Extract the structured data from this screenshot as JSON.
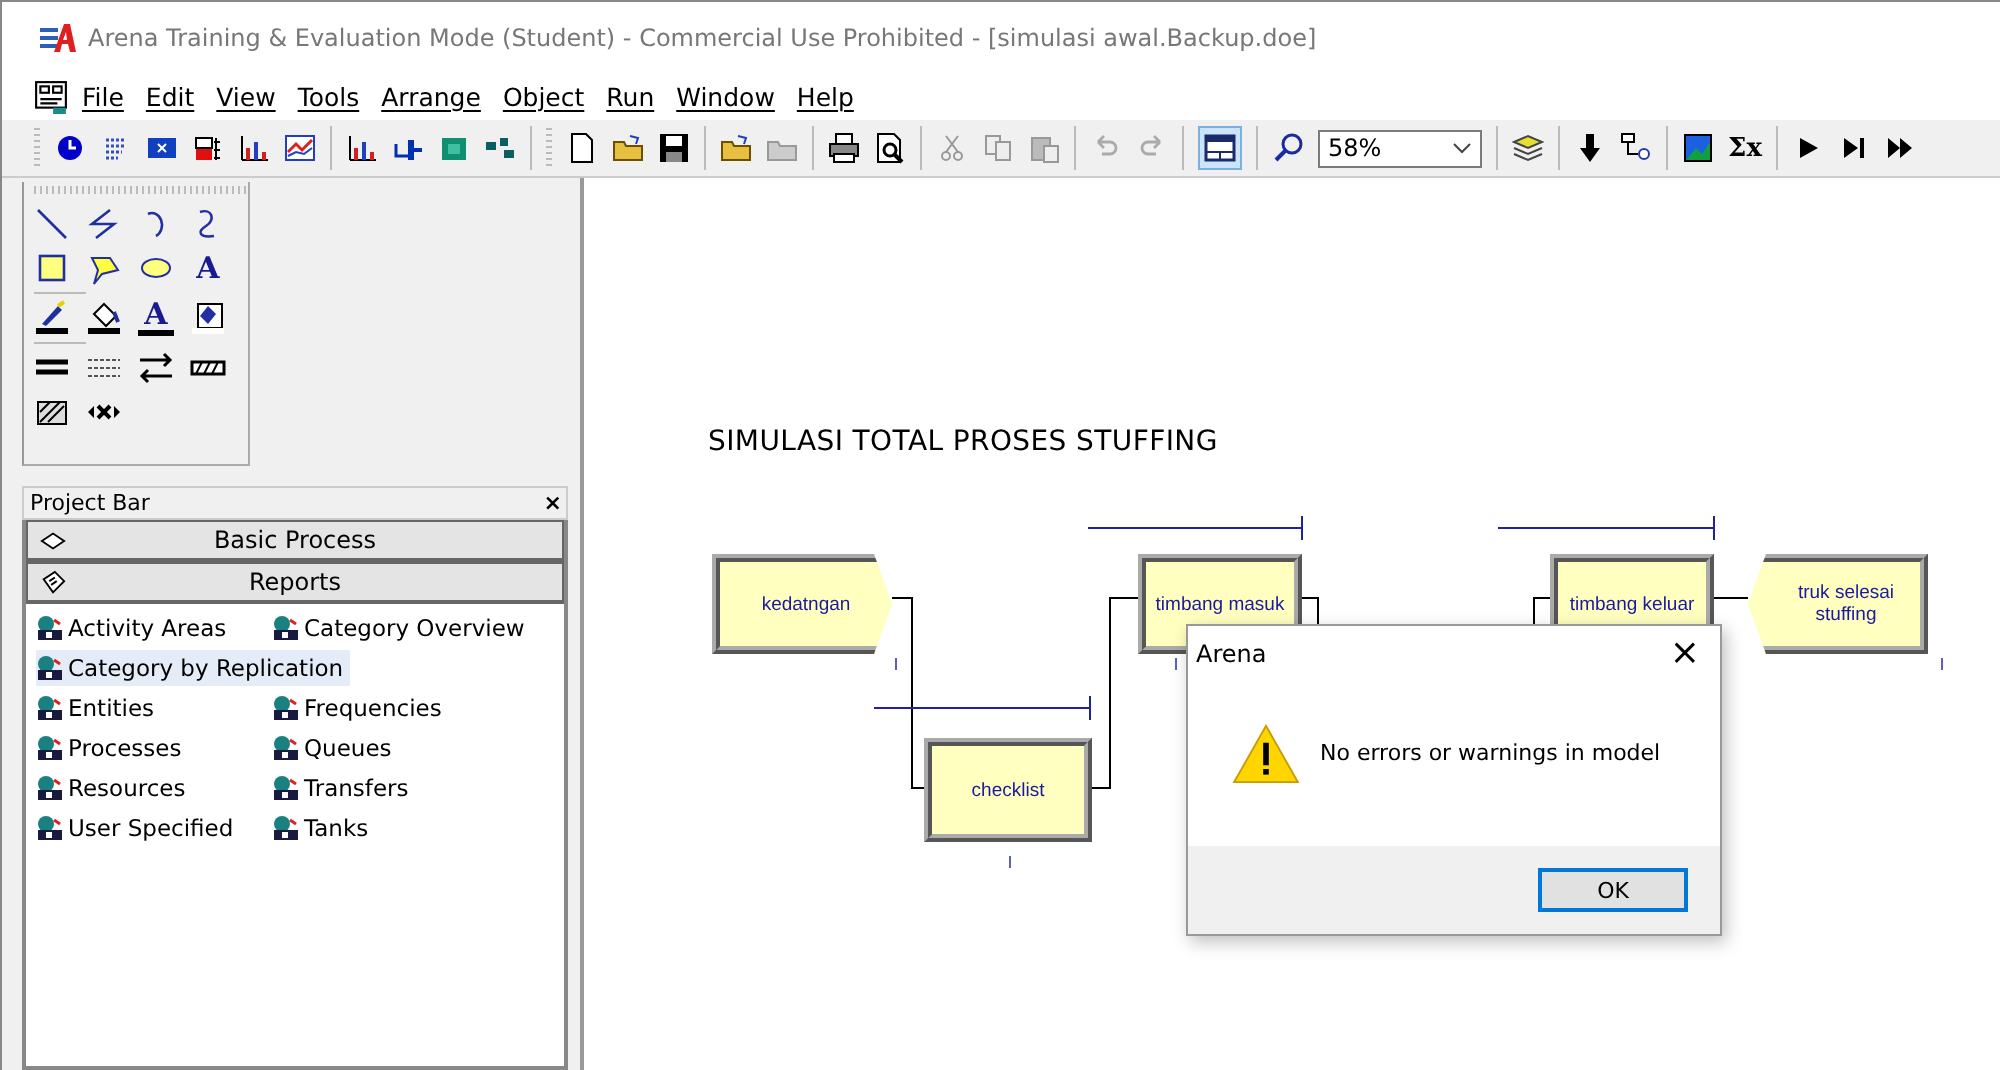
{
  "window": {
    "title": "Arena Training & Evaluation Mode (Student) - Commercial Use Prohibited - [simulasi awal.Backup.doe]"
  },
  "menu": [
    "File",
    "Edit",
    "View",
    "Tools",
    "Arrange",
    "Object",
    "Run",
    "Window",
    "Help"
  ],
  "toolbar": {
    "zoom": "58%",
    "split_view_pressed": true,
    "sum_glyph": "Σx"
  },
  "draw_toolbar": {
    "text_glyphs": [
      "A",
      "A"
    ]
  },
  "project_bar": {
    "title": "Project Bar",
    "close": "×",
    "panels": [
      {
        "label": "Basic Process",
        "kind": "process"
      },
      {
        "label": "Reports",
        "kind": "reports"
      }
    ],
    "reports": [
      {
        "label": "Activity Areas",
        "selected": false
      },
      {
        "label": "Category Overview",
        "selected": false
      },
      {
        "label": "Category by Replication",
        "selected": true
      },
      {
        "label": "Entities",
        "selected": false
      },
      {
        "label": "Frequencies",
        "selected": false
      },
      {
        "label": "Processes",
        "selected": false
      },
      {
        "label": "Queues",
        "selected": false
      },
      {
        "label": "Resources",
        "selected": false
      },
      {
        "label": "Transfers",
        "selected": false
      },
      {
        "label": "User Specified",
        "selected": false
      },
      {
        "label": "Tanks",
        "selected": false
      }
    ]
  },
  "canvas": {
    "title": "SIMULASI TOTAL PROSES STUFFING",
    "modules": [
      {
        "label": "kedatngan",
        "kind": "create"
      },
      {
        "label": "checklist",
        "kind": "process"
      },
      {
        "label": "timbang masuk",
        "kind": "process"
      },
      {
        "label": "timbang keluar",
        "kind": "process"
      },
      {
        "label": "truk selesai stuffing",
        "kind": "dispose"
      }
    ]
  },
  "dialog": {
    "title": "Arena",
    "close": "×",
    "message": "No errors or warnings in model",
    "button": "OK"
  }
}
